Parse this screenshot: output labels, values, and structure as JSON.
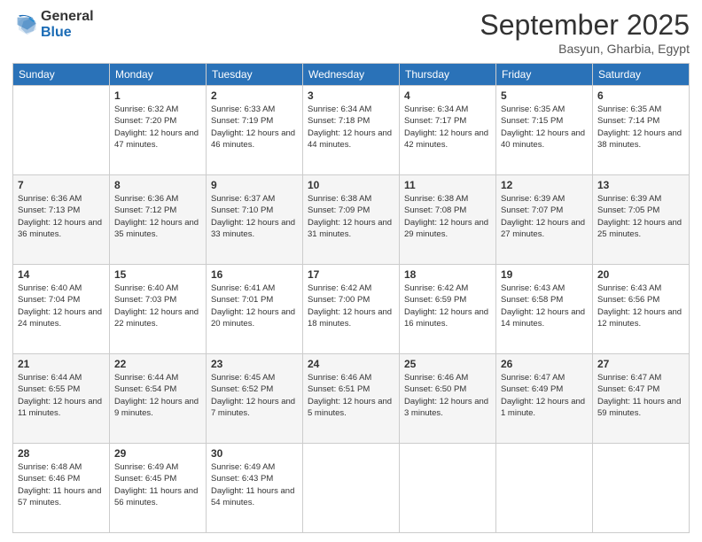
{
  "logo": {
    "general": "General",
    "blue": "Blue"
  },
  "header": {
    "month": "September 2025",
    "location": "Basyun, Gharbia, Egypt"
  },
  "days_of_week": [
    "Sunday",
    "Monday",
    "Tuesday",
    "Wednesday",
    "Thursday",
    "Friday",
    "Saturday"
  ],
  "weeks": [
    [
      {
        "day": null
      },
      {
        "day": 1,
        "sunrise": "6:32 AM",
        "sunset": "7:20 PM",
        "daylight": "12 hours and 47 minutes."
      },
      {
        "day": 2,
        "sunrise": "6:33 AM",
        "sunset": "7:19 PM",
        "daylight": "12 hours and 46 minutes."
      },
      {
        "day": 3,
        "sunrise": "6:34 AM",
        "sunset": "7:18 PM",
        "daylight": "12 hours and 44 minutes."
      },
      {
        "day": 4,
        "sunrise": "6:34 AM",
        "sunset": "7:17 PM",
        "daylight": "12 hours and 42 minutes."
      },
      {
        "day": 5,
        "sunrise": "6:35 AM",
        "sunset": "7:15 PM",
        "daylight": "12 hours and 40 minutes."
      },
      {
        "day": 6,
        "sunrise": "6:35 AM",
        "sunset": "7:14 PM",
        "daylight": "12 hours and 38 minutes."
      }
    ],
    [
      {
        "day": 7,
        "sunrise": "6:36 AM",
        "sunset": "7:13 PM",
        "daylight": "12 hours and 36 minutes."
      },
      {
        "day": 8,
        "sunrise": "6:36 AM",
        "sunset": "7:12 PM",
        "daylight": "12 hours and 35 minutes."
      },
      {
        "day": 9,
        "sunrise": "6:37 AM",
        "sunset": "7:10 PM",
        "daylight": "12 hours and 33 minutes."
      },
      {
        "day": 10,
        "sunrise": "6:38 AM",
        "sunset": "7:09 PM",
        "daylight": "12 hours and 31 minutes."
      },
      {
        "day": 11,
        "sunrise": "6:38 AM",
        "sunset": "7:08 PM",
        "daylight": "12 hours and 29 minutes."
      },
      {
        "day": 12,
        "sunrise": "6:39 AM",
        "sunset": "7:07 PM",
        "daylight": "12 hours and 27 minutes."
      },
      {
        "day": 13,
        "sunrise": "6:39 AM",
        "sunset": "7:05 PM",
        "daylight": "12 hours and 25 minutes."
      }
    ],
    [
      {
        "day": 14,
        "sunrise": "6:40 AM",
        "sunset": "7:04 PM",
        "daylight": "12 hours and 24 minutes."
      },
      {
        "day": 15,
        "sunrise": "6:40 AM",
        "sunset": "7:03 PM",
        "daylight": "12 hours and 22 minutes."
      },
      {
        "day": 16,
        "sunrise": "6:41 AM",
        "sunset": "7:01 PM",
        "daylight": "12 hours and 20 minutes."
      },
      {
        "day": 17,
        "sunrise": "6:42 AM",
        "sunset": "7:00 PM",
        "daylight": "12 hours and 18 minutes."
      },
      {
        "day": 18,
        "sunrise": "6:42 AM",
        "sunset": "6:59 PM",
        "daylight": "12 hours and 16 minutes."
      },
      {
        "day": 19,
        "sunrise": "6:43 AM",
        "sunset": "6:58 PM",
        "daylight": "12 hours and 14 minutes."
      },
      {
        "day": 20,
        "sunrise": "6:43 AM",
        "sunset": "6:56 PM",
        "daylight": "12 hours and 12 minutes."
      }
    ],
    [
      {
        "day": 21,
        "sunrise": "6:44 AM",
        "sunset": "6:55 PM",
        "daylight": "12 hours and 11 minutes."
      },
      {
        "day": 22,
        "sunrise": "6:44 AM",
        "sunset": "6:54 PM",
        "daylight": "12 hours and 9 minutes."
      },
      {
        "day": 23,
        "sunrise": "6:45 AM",
        "sunset": "6:52 PM",
        "daylight": "12 hours and 7 minutes."
      },
      {
        "day": 24,
        "sunrise": "6:46 AM",
        "sunset": "6:51 PM",
        "daylight": "12 hours and 5 minutes."
      },
      {
        "day": 25,
        "sunrise": "6:46 AM",
        "sunset": "6:50 PM",
        "daylight": "12 hours and 3 minutes."
      },
      {
        "day": 26,
        "sunrise": "6:47 AM",
        "sunset": "6:49 PM",
        "daylight": "12 hours and 1 minute."
      },
      {
        "day": 27,
        "sunrise": "6:47 AM",
        "sunset": "6:47 PM",
        "daylight": "11 hours and 59 minutes."
      }
    ],
    [
      {
        "day": 28,
        "sunrise": "6:48 AM",
        "sunset": "6:46 PM",
        "daylight": "11 hours and 57 minutes."
      },
      {
        "day": 29,
        "sunrise": "6:49 AM",
        "sunset": "6:45 PM",
        "daylight": "11 hours and 56 minutes."
      },
      {
        "day": 30,
        "sunrise": "6:49 AM",
        "sunset": "6:43 PM",
        "daylight": "11 hours and 54 minutes."
      },
      {
        "day": null
      },
      {
        "day": null
      },
      {
        "day": null
      },
      {
        "day": null
      }
    ]
  ],
  "labels": {
    "sunrise": "Sunrise:",
    "sunset": "Sunset:",
    "daylight": "Daylight:"
  }
}
